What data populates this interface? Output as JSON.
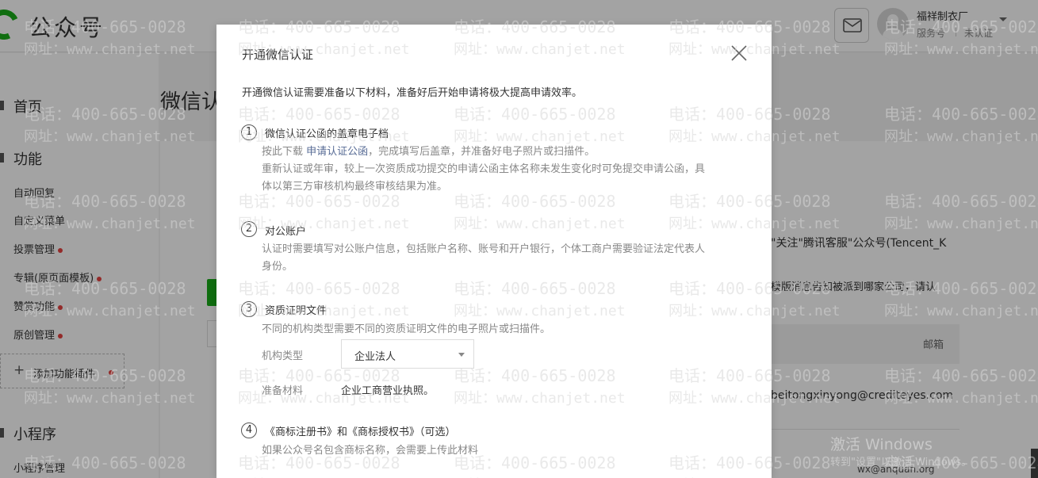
{
  "topbar": {
    "app_title": "公众号",
    "account": {
      "name": "福祥制衣厂",
      "type": "服务号",
      "status": "未认证"
    }
  },
  "sidebar": {
    "home": "首页",
    "features_header": "功能",
    "feature_items": [
      {
        "label": "自动回复",
        "dot": false
      },
      {
        "label": "自定义菜单",
        "dot": false
      },
      {
        "label": "投票管理",
        "dot": true
      },
      {
        "label": "专辑(原页面模板)",
        "dot": true
      },
      {
        "label": "赞赏功能",
        "dot": true
      },
      {
        "label": "原创管理",
        "dot": true
      }
    ],
    "add_plugin": "添加功能插件",
    "mini_program_header": "小程序",
    "mini_program_item": "小程序管理"
  },
  "main": {
    "title": "微信认",
    "right_text_1": "\"关注\"腾讯客服\"公众号(Tencent_K",
    "right_text_2": "模版消息告知被派到哪家公司，请认",
    "email_field_label": "邮箱",
    "email_text": "beitongxinyong@crediteyes.com"
  },
  "system": {
    "activate_title": "激活 Windows",
    "activate_hint": "转到\"设置\"以激活 Windows。",
    "credit": "wx@anquan.org"
  },
  "watermark": {
    "phone": "电话：400-665-0028",
    "url": "网址：www.chanjet.net"
  },
  "dialog": {
    "title": "开通微信认证",
    "intro": "开通微信认证需要准备以下材料，准备好后开始申请将极大提高申请效率。",
    "steps": [
      {
        "num": "1",
        "title": "微信认证公函的盖章电子档",
        "desc_prefix": "按此下载 ",
        "desc_link": "申请认证公函",
        "desc_suffix": "，完成填写后盖章，并准备好电子照片或扫描件。",
        "desc_line2": "重新认证或年审，较上一次资质成功提交的申请公函主体名称未发生变化时可免提交申请公函，具",
        "desc_line3": "体以第三方审核机构最终审核结果为准。"
      },
      {
        "num": "2",
        "title": "对公账户",
        "desc_line1": "认证时需要填写对公账户信息，包括账户名称、账号和开户银行，个体工商户需要验证法定代表人",
        "desc_line2": "身份。"
      },
      {
        "num": "3",
        "title": "资质证明文件",
        "desc_line1": "不同的机构类型需要不同的资质证明文件的电子照片或扫描件。",
        "org_type_label": "机构类型",
        "org_type_value": "企业法人",
        "prep_label": "准备材料",
        "prep_value": "企业工商营业执照。"
      },
      {
        "num": "4",
        "title": "《商标注册书》和《商标授权书》（可选）",
        "desc_line1": "如果公众号名包含商标名称，会需要上传此材料"
      }
    ]
  },
  "colors": {
    "brand_green": "#1aad19",
    "alert_red": "#e64340",
    "link_blue": "#576b95"
  }
}
